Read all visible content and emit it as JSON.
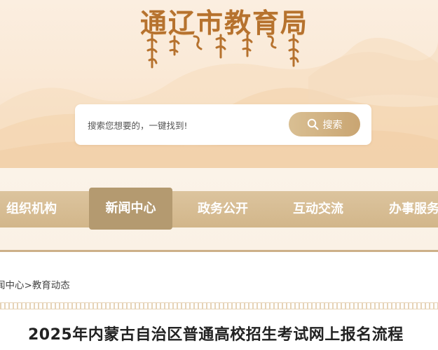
{
  "header": {
    "site_title": "通辽市教育局",
    "emblem_name": "mongolian-script-title"
  },
  "search": {
    "placeholder": "搜索您想要的，一键找到!",
    "button_label": "搜索",
    "button_icon": "search-icon"
  },
  "nav": {
    "items": [
      {
        "label": "组织机构",
        "active": false
      },
      {
        "label": "新闻中心",
        "active": true
      },
      {
        "label": "政务公开",
        "active": false
      },
      {
        "label": "互动交流",
        "active": false
      },
      {
        "label": "办事服务",
        "active": false
      }
    ]
  },
  "breadcrumb": {
    "items": [
      "闻中心",
      "教育动态"
    ],
    "separator": ">"
  },
  "article": {
    "title": "2025年内蒙古自治区普通高校招生考试网上报名流程"
  },
  "colors": {
    "title_gold": "#b6722e",
    "nav_bar": "#d2b68a",
    "nav_active": "#b49a70",
    "search_button": "#c9a572"
  }
}
